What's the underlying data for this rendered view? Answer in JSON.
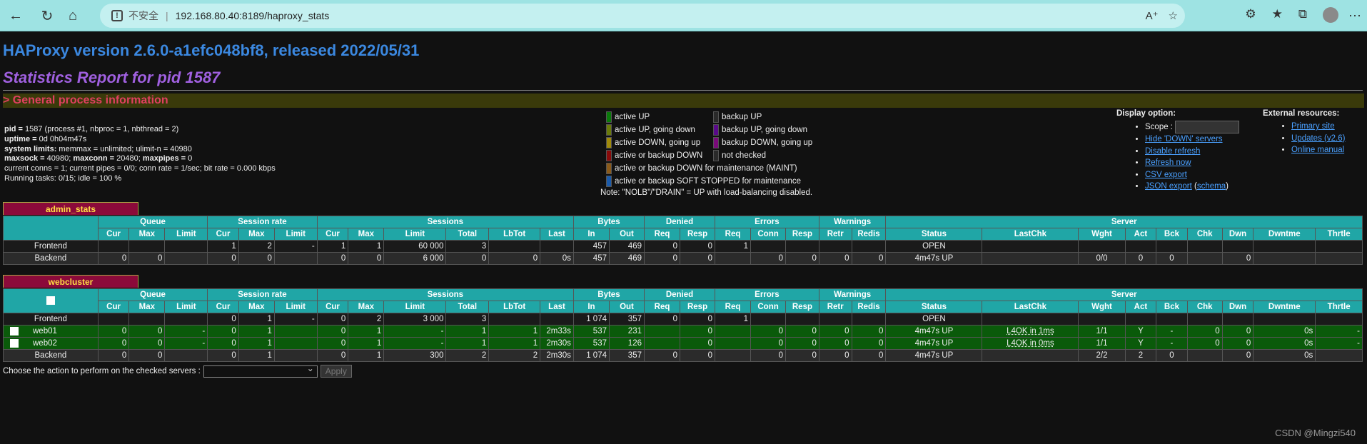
{
  "browser": {
    "not_secure": "不安全",
    "url": "192.168.80.40:8189/haproxy_stats"
  },
  "header": {
    "version": "HAProxy version 2.6.0-a1efc048bf8, released 2022/05/31",
    "report": "Statistics Report for pid 1587",
    "gpi": "> General process information"
  },
  "procinfo": {
    "pid_label": "pid = ",
    "pid_value": "1587 (process #1, nbproc = 1, nbthread = 2)",
    "uptime_label": "uptime = ",
    "uptime_value": "0d 0h04m47s",
    "syslimits_label": "system limits:",
    "syslimits_value": " memmax = unlimited; ulimit-n = 40980",
    "maxsock_label": "maxsock = ",
    "maxsock_value": "40980; ",
    "maxconn_label": "maxconn = ",
    "maxconn_value": "20480; ",
    "maxpipes_label": "maxpipes = ",
    "maxpipes_value": "0",
    "line5": "current conns = 1; current pipes = 0/0; conn rate = 1/sec; bit rate = 0.000 kbps",
    "line6": "Running tasks: 0/15; idle = 100 %"
  },
  "legend": {
    "col1": [
      {
        "label": "active UP",
        "color": "#0a7a0a"
      },
      {
        "label": "active UP, going down",
        "color": "#6a7a0a"
      },
      {
        "label": "active DOWN, going up",
        "color": "#a08a0a"
      },
      {
        "label": "active or backup DOWN",
        "color": "#8a0a0a"
      }
    ],
    "col2": [
      {
        "label": "backup UP",
        "color": "#2a2a2a"
      },
      {
        "label": "backup UP, going down",
        "color": "#5a0a8a"
      },
      {
        "label": "backup DOWN, going up",
        "color": "#7a0a7a"
      },
      {
        "label": "not checked",
        "color": "#2a2a2a"
      }
    ],
    "maint": {
      "label": "active or backup DOWN for maintenance (MAINT)",
      "color": "#8a5a1a"
    },
    "soft": {
      "label": "active or backup SOFT STOPPED for maintenance",
      "color": "#1a5aaa"
    },
    "note": "Note: \"NOLB\"/\"DRAIN\" = UP with load-balancing disabled."
  },
  "display_options": {
    "title": "Display option:",
    "scope": "Scope :",
    "hide_down": "Hide 'DOWN' servers",
    "disable_refresh": "Disable refresh",
    "refresh_now": "Refresh now",
    "csv_export": "CSV export",
    "json_export": "JSON export",
    "schema": "schema"
  },
  "external": {
    "title": "External resources:",
    "primary": "Primary site",
    "updates": "Updates (v2.6)",
    "manual": "Online manual"
  },
  "headers": {
    "groups": [
      "Queue",
      "Session rate",
      "Sessions",
      "Bytes",
      "Denied",
      "Errors",
      "Warnings",
      "Server"
    ],
    "cols": [
      "Cur",
      "Max",
      "Limit",
      "Cur",
      "Max",
      "Limit",
      "Cur",
      "Max",
      "Limit",
      "Total",
      "LbTot",
      "Last",
      "In",
      "Out",
      "Req",
      "Resp",
      "Req",
      "Conn",
      "Resp",
      "Retr",
      "Redis",
      "Status",
      "LastChk",
      "Wght",
      "Act",
      "Bck",
      "Chk",
      "Dwn",
      "Dwntme",
      "Thrtle"
    ]
  },
  "proxies": [
    {
      "name": "admin_stats",
      "rows": [
        {
          "type": "fe",
          "cells": [
            "Frontend",
            "",
            "",
            "",
            "1",
            "2",
            "-",
            "1",
            "1",
            "60 000",
            "3",
            "",
            "",
            "457",
            "469",
            "0",
            "0",
            "1",
            "",
            "",
            "",
            "",
            "OPEN",
            "",
            "",
            "",
            "",
            "",
            "",
            "",
            ""
          ]
        },
        {
          "type": "be",
          "cells": [
            "Backend",
            "0",
            "0",
            "",
            "0",
            "0",
            "",
            "0",
            "0",
            "6 000",
            "0",
            "0",
            "0s",
            "457",
            "469",
            "0",
            "0",
            "",
            "0",
            "0",
            "0",
            "0",
            "4m47s UP",
            "",
            "0/0",
            "0",
            "0",
            "",
            "0",
            "",
            ""
          ]
        }
      ]
    },
    {
      "name": "webcluster",
      "rows": [
        {
          "type": "fe",
          "cells": [
            "Frontend",
            "",
            "",
            "",
            "0",
            "1",
            "-",
            "0",
            "2",
            "3 000",
            "3",
            "",
            "",
            "1 074",
            "357",
            "0",
            "0",
            "1",
            "",
            "",
            "",
            "",
            "OPEN",
            "",
            "",
            "",
            "",
            "",
            "",
            "",
            ""
          ]
        },
        {
          "type": "srv",
          "cells": [
            "web01",
            "0",
            "0",
            "-",
            "0",
            "1",
            "",
            "0",
            "1",
            "-",
            "1",
            "1",
            "2m33s",
            "537",
            "231",
            "",
            "0",
            "",
            "0",
            "0",
            "0",
            "0",
            "4m47s UP",
            "L4OK in 1ms",
            "1/1",
            "Y",
            "-",
            "0",
            "0",
            "0s",
            "-"
          ]
        },
        {
          "type": "srv",
          "cells": [
            "web02",
            "0",
            "0",
            "-",
            "0",
            "1",
            "",
            "0",
            "1",
            "-",
            "1",
            "1",
            "2m30s",
            "537",
            "126",
            "",
            "0",
            "",
            "0",
            "0",
            "0",
            "0",
            "4m47s UP",
            "L4OK in 0ms",
            "1/1",
            "Y",
            "-",
            "0",
            "0",
            "0s",
            "-"
          ]
        },
        {
          "type": "be",
          "cells": [
            "Backend",
            "0",
            "0",
            "",
            "0",
            "1",
            "",
            "0",
            "1",
            "300",
            "2",
            "2",
            "2m30s",
            "1 074",
            "357",
            "0",
            "0",
            "",
            "0",
            "0",
            "0",
            "0",
            "4m47s UP",
            "",
            "2/2",
            "2",
            "0",
            "",
            "0",
            "0s",
            ""
          ]
        }
      ]
    }
  ],
  "actions": {
    "label": "Choose the action to perform on the checked servers :",
    "apply": "Apply"
  },
  "watermark": "CSDN @Mingzi540"
}
